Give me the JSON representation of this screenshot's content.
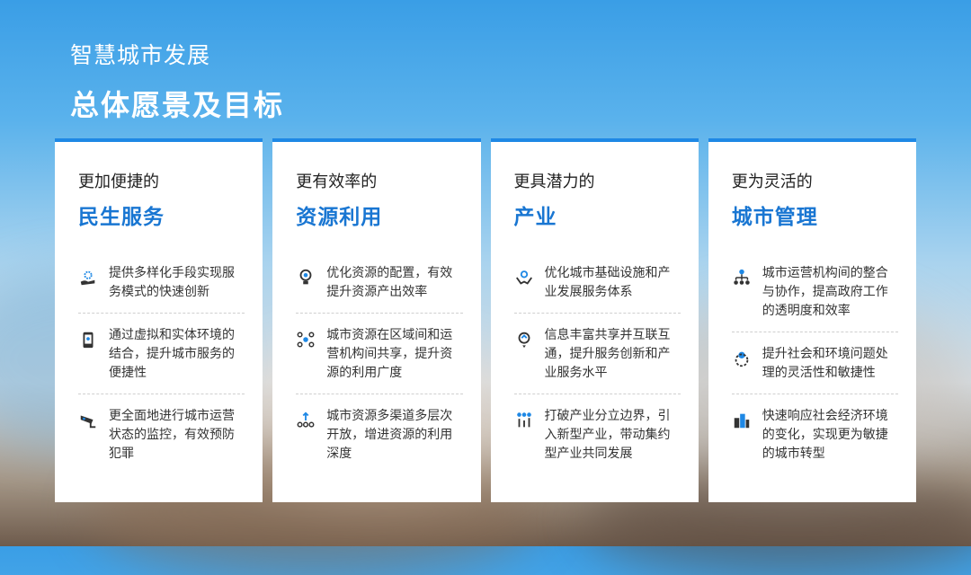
{
  "header": {
    "subtitle": "智慧城市发展",
    "title": "总体愿景及目标"
  },
  "colors": {
    "accent": "#1976d2",
    "accent_border": "#1e88e5",
    "text": "#333333"
  },
  "cards": [
    {
      "sub": "更加便捷的",
      "head": "民生服务",
      "items": [
        {
          "icon": "hand-gear-icon",
          "text": "提供多样化手段实现服务模式的快速创新"
        },
        {
          "icon": "phone-icon",
          "text": "通过虚拟和实体环境的结合，提升城市服务的便捷性"
        },
        {
          "icon": "cctv-camera-icon",
          "text": "更全面地进行城市运营状态的监控，有效预防犯罪"
        }
      ]
    },
    {
      "sub": "更有效率的",
      "head": "资源利用",
      "items": [
        {
          "icon": "bulb-gear-icon",
          "text": "优化资源的配置，有效提升资源产出效率"
        },
        {
          "icon": "network-icon",
          "text": "城市资源在区域间和运营机构间共享，提升资源的利用广度"
        },
        {
          "icon": "channels-icon",
          "text": "城市资源多渠道多层次开放，增进资源的利用深度"
        }
      ]
    },
    {
      "sub": "更具潜力的",
      "head": "产业",
      "items": [
        {
          "icon": "hands-gear-icon",
          "text": "优化城市基础设施和产业发展服务体系"
        },
        {
          "icon": "lightbulb-icon",
          "text": "信息丰富共享并互联互通，提升服务创新和产业服务水平"
        },
        {
          "icon": "bars-bulb-icon",
          "text": "打破产业分立边界，引入新型产业，带动集约型产业共同发展"
        }
      ]
    },
    {
      "sub": "更为灵活的",
      "head": "城市管理",
      "items": [
        {
          "icon": "org-chart-icon",
          "text": "城市运营机构间的整合与协作，提高政府工作的透明度和效率"
        },
        {
          "icon": "gear-bulb-icon",
          "text": "提升社会和环境问题处理的灵活性和敏捷性"
        },
        {
          "icon": "buildings-icon",
          "text": "快速响应社会经济环境的变化，实现更为敏捷的城市转型"
        }
      ]
    }
  ]
}
